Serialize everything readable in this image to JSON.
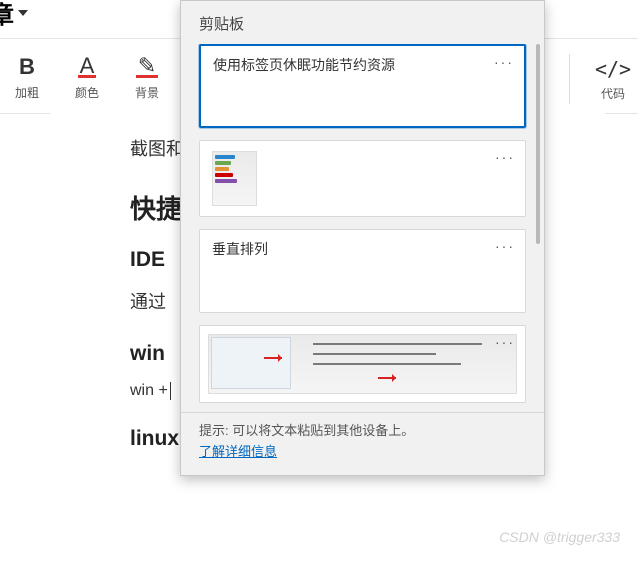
{
  "header": {
    "title_fragment": "章"
  },
  "toolbar": {
    "bold": {
      "icon": "B",
      "label": "加粗"
    },
    "color": {
      "icon": "A",
      "label": "颜色"
    },
    "background": {
      "icon": "✎",
      "label": "背景"
    },
    "code": {
      "icon": "</>",
      "label": "代码"
    }
  },
  "editor": {
    "line1": "截图和",
    "h2": "快捷",
    "h3_1": "IDE",
    "line2": "通过",
    "h3_2": "win",
    "line3": "win + ",
    "h3_3": "linux 快捷键"
  },
  "clipboard": {
    "title": "剪贴板",
    "items": [
      {
        "type": "text",
        "text": "使用标签页休眠功能节约资源",
        "selected": true
      },
      {
        "type": "image",
        "thumb": "colors"
      },
      {
        "type": "text",
        "text": "垂直排列"
      },
      {
        "type": "image",
        "thumb": "dialog"
      }
    ],
    "dots": "···",
    "footer_tip": "提示: 可以将文本粘贴到其他设备上。",
    "footer_link": "了解详细信息"
  },
  "watermark": "CSDN @trigger333"
}
